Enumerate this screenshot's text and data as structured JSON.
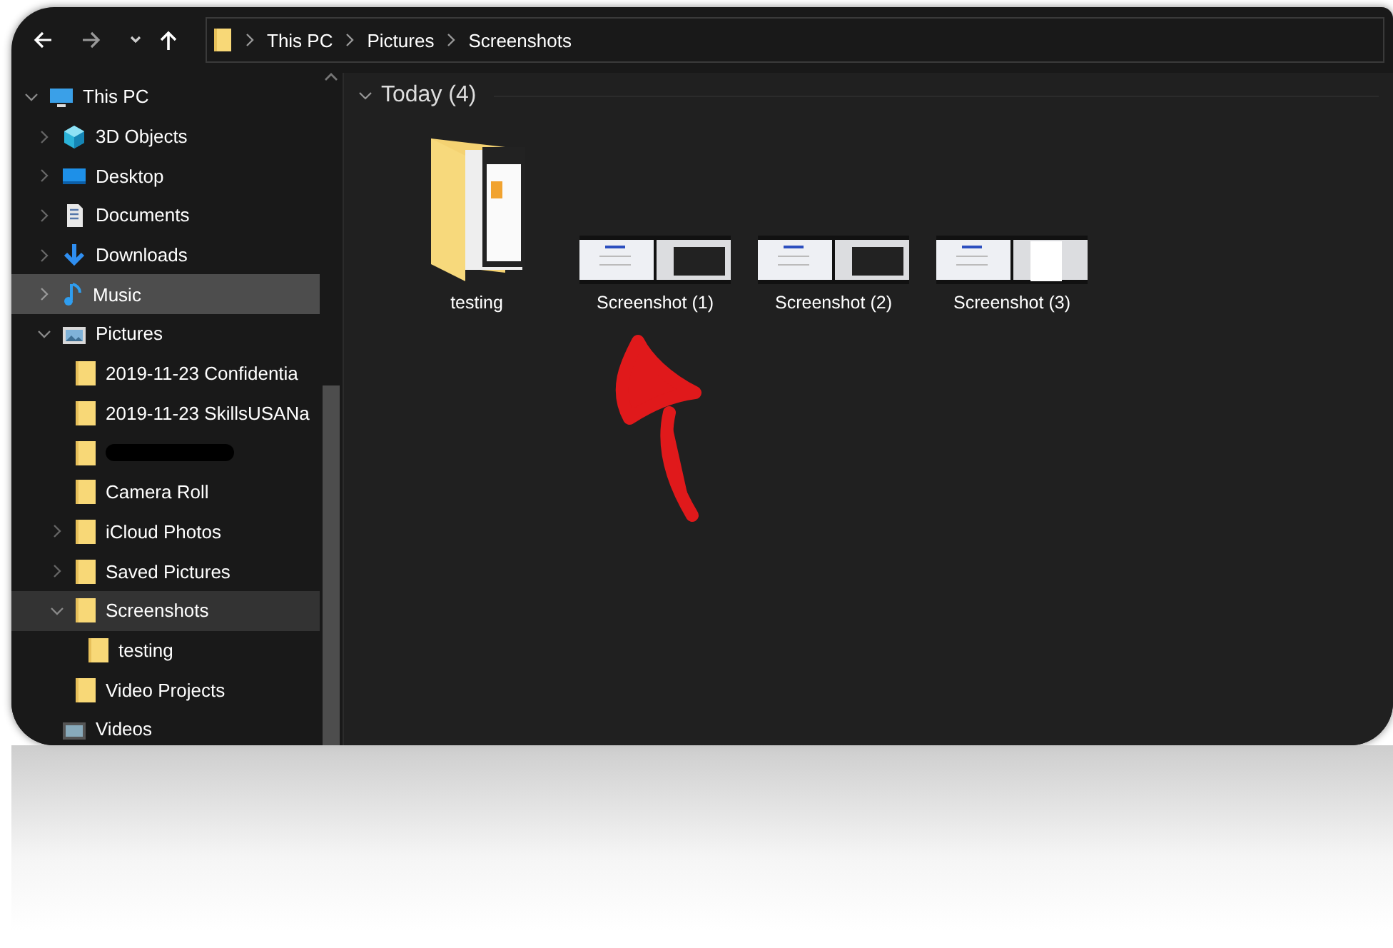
{
  "address_bar": {
    "crumbs": [
      "This PC",
      "Pictures",
      "Screenshots"
    ]
  },
  "navigation_pane": {
    "items": [
      {
        "label": "This PC",
        "kind": "pc",
        "expanded": true,
        "selected": false,
        "hovered": false,
        "children": [
          {
            "label": "3D Objects",
            "kind": "cube",
            "expanded": false,
            "selected": false,
            "hovered": false
          },
          {
            "label": "Desktop",
            "kind": "desktop",
            "expanded": false,
            "selected": false,
            "hovered": false
          },
          {
            "label": "Documents",
            "kind": "document",
            "expanded": false,
            "selected": false,
            "hovered": false
          },
          {
            "label": "Downloads",
            "kind": "download",
            "expanded": false,
            "selected": false,
            "hovered": false
          },
          {
            "label": "Music",
            "kind": "music",
            "expanded": false,
            "selected": false,
            "hovered": true
          },
          {
            "label": "Pictures",
            "kind": "picture",
            "expanded": true,
            "selected": false,
            "hovered": false,
            "children": [
              {
                "label": "2019-11-23 Confidentia",
                "kind": "folder",
                "selected": false,
                "hovered": false
              },
              {
                "label": "2019-11-23 SkillsUSANa",
                "kind": "folder",
                "selected": false,
                "hovered": false
              },
              {
                "kind": "folder",
                "redacted": true,
                "selected": false,
                "hovered": false
              },
              {
                "label": "Camera Roll",
                "kind": "folder",
                "selected": false,
                "hovered": false
              },
              {
                "label": "iCloud Photos",
                "kind": "folder",
                "expanded": false,
                "selected": false,
                "hovered": false
              },
              {
                "label": "Saved Pictures",
                "kind": "folder",
                "expanded": false,
                "selected": false,
                "hovered": false
              },
              {
                "label": "Screenshots",
                "kind": "folder",
                "expanded": true,
                "selected": true,
                "hovered": false,
                "children": [
                  {
                    "label": "testing",
                    "kind": "folder",
                    "selected": false,
                    "hovered": false
                  }
                ]
              },
              {
                "label": "Video Projects",
                "kind": "folder",
                "selected": false,
                "hovered": false
              }
            ]
          },
          {
            "label": "Videos",
            "kind": "video",
            "selected": false,
            "hovered": false
          }
        ]
      }
    ]
  },
  "content": {
    "groups": [
      {
        "title": "Today (4)",
        "expanded": true,
        "items": [
          {
            "kind": "folder",
            "label": "testing"
          },
          {
            "kind": "image",
            "label": "Screenshot (1)"
          },
          {
            "kind": "image",
            "label": "Screenshot (2)"
          },
          {
            "kind": "image",
            "label": "Screenshot (3)"
          }
        ]
      }
    ]
  }
}
